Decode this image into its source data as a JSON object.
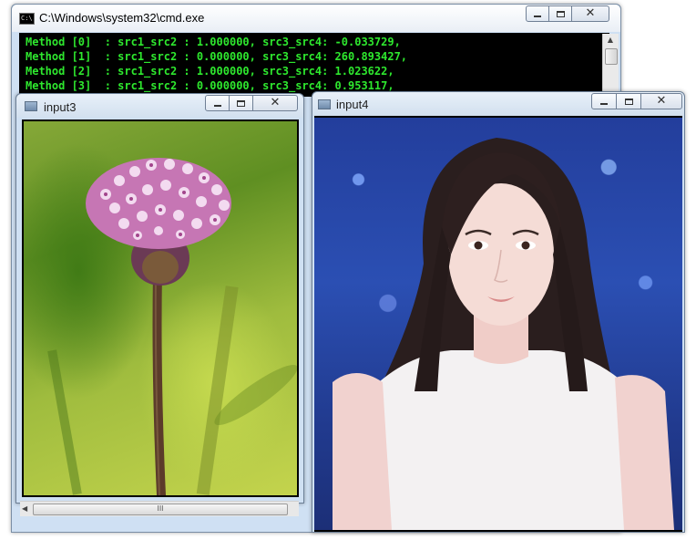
{
  "cmd": {
    "title": "C:\\Windows\\system32\\cmd.exe",
    "icon_text": "C:\\",
    "lines": [
      "Method [0]  : src1_src2 : 1.000000, src3_src4: -0.033729,",
      "Method [1]  : src1_src2 : 0.000000, src3_src4: 260.893427,",
      "Method [2]  : src1_src2 : 1.000000, src3_src4: 1.023622,",
      "Method [3]  : src1_src2 : 0.000000, src3_src4: 0.953117,"
    ],
    "text_color": "#2ee82e",
    "background": "#000000"
  },
  "window_input3": {
    "title": "input3",
    "scroll_grip": "III"
  },
  "window_input4": {
    "title": "input4"
  },
  "icons": {
    "minimize": "minimize-icon",
    "maximize": "maximize-icon",
    "close": "close-icon"
  }
}
